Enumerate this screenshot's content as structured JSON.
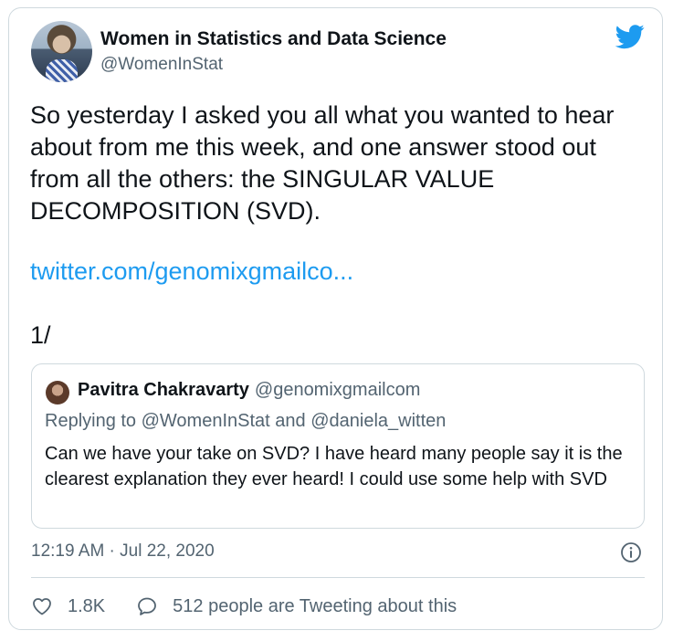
{
  "author": {
    "name": "Women in Statistics and Data Science",
    "handle": "@WomenInStat"
  },
  "tweet": {
    "paragraph1": "So yesterday I asked you all what you wanted to hear about from me this week, and one answer stood out from all the others: the SINGULAR VALUE DECOMPOSITION (SVD).",
    "link": "twitter.com/genomixgmailco...",
    "thread_marker": "1/"
  },
  "quoted": {
    "name": "Pavitra Chakravarty",
    "handle": "@genomixgmailcom",
    "replying_to": "Replying to @WomenInStat and @daniela_witten",
    "text": "Can we have your take on SVD? I have heard many people say it is the clearest explanation they ever heard! I could use some help with SVD"
  },
  "timestamp": "12:19 AM · Jul 22, 2020",
  "actions": {
    "likes": "1.8K",
    "replies_label": "512 people are Tweeting about this"
  },
  "icons": {
    "brand": "twitter-bird-icon",
    "info": "info-icon",
    "like": "heart-icon",
    "reply": "speech-bubble-icon"
  },
  "colors": {
    "brand": "#1d9bf0",
    "text": "#0f1419",
    "secondary": "#536471",
    "border": "#cfd9de"
  }
}
